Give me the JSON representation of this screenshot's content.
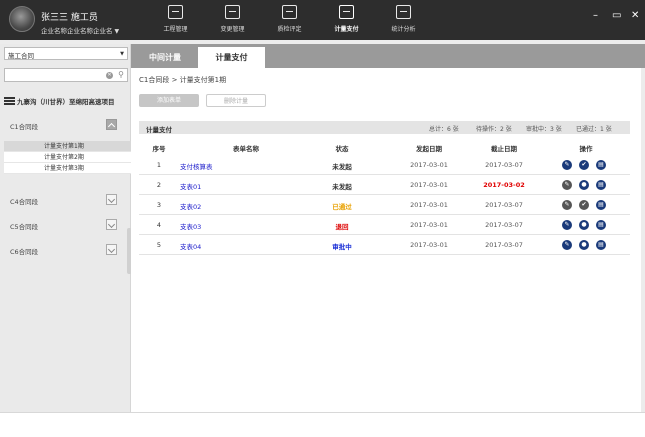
{
  "user": {
    "name": "张三三  施工员",
    "company": "企业名称企业名称企业名"
  },
  "nav": [
    {
      "label": "工程管理",
      "icon": "project-icon"
    },
    {
      "label": "变更管理",
      "icon": "change-icon"
    },
    {
      "label": "质检评定",
      "icon": "inspection-icon"
    },
    {
      "label": "计量支付",
      "icon": "payment-icon",
      "active": true
    },
    {
      "label": "统计分析",
      "icon": "statistics-icon"
    }
  ],
  "sidebar": {
    "contract_select": "施工合同",
    "search_placeholder": "",
    "project": "九寨沟（川甘界）至绵阳高速项目",
    "sections": [
      {
        "label": "C1合同段",
        "open": true,
        "items": [
          "计量支付第1期",
          "计量支付第2期",
          "计量支付第3期"
        ]
      },
      {
        "label": "C4合同段",
        "open": false
      },
      {
        "label": "C5合同段",
        "open": false
      },
      {
        "label": "C6合同段",
        "open": false
      }
    ]
  },
  "tabs": [
    {
      "label": "中间计量",
      "active": false
    },
    {
      "label": "计量支付",
      "active": true
    }
  ],
  "breadcrumb": "C1合同段 > 计量支付第1期",
  "buttons": {
    "add": "添加表单",
    "delete": "删除计量"
  },
  "table": {
    "title": "计量支付",
    "stats": {
      "total": "总计：6 张",
      "pending": "待操作：2 张",
      "reviewing": "审批中：3 张",
      "passed": "已通过：1 张"
    },
    "columns": [
      "序号",
      "表单名称",
      "状态",
      "发起日期",
      "截止日期",
      "操作"
    ],
    "rows": [
      {
        "no": "1",
        "name": "支付核算表",
        "status": "未发起",
        "status_color": "#333333",
        "start": "2017-03-01",
        "end": "2017-03-07",
        "overdue": false
      },
      {
        "no": "2",
        "name": "支表01",
        "status": "未发起",
        "status_color": "#333333",
        "start": "2017-03-01",
        "end": "2017-03-02",
        "overdue": true
      },
      {
        "no": "3",
        "name": "支表02",
        "status": "已通过",
        "status_color": "#e8a000",
        "start": "2017-03-01",
        "end": "2017-03-07",
        "overdue": false
      },
      {
        "no": "4",
        "name": "支表03",
        "status": "退回",
        "status_color": "#dd0000",
        "start": "2017-03-01",
        "end": "2017-03-07",
        "overdue": false
      },
      {
        "no": "5",
        "name": "支表04",
        "status": "审批中",
        "status_color": "#1a2fd6",
        "start": "2017-03-01",
        "end": "2017-03-07",
        "overdue": false
      }
    ]
  },
  "colors": {
    "topbar": "#2d2d2d",
    "tabbar": "#9a9a9a",
    "action_icon": "#1a3a7a",
    "link": "#2020cc"
  }
}
